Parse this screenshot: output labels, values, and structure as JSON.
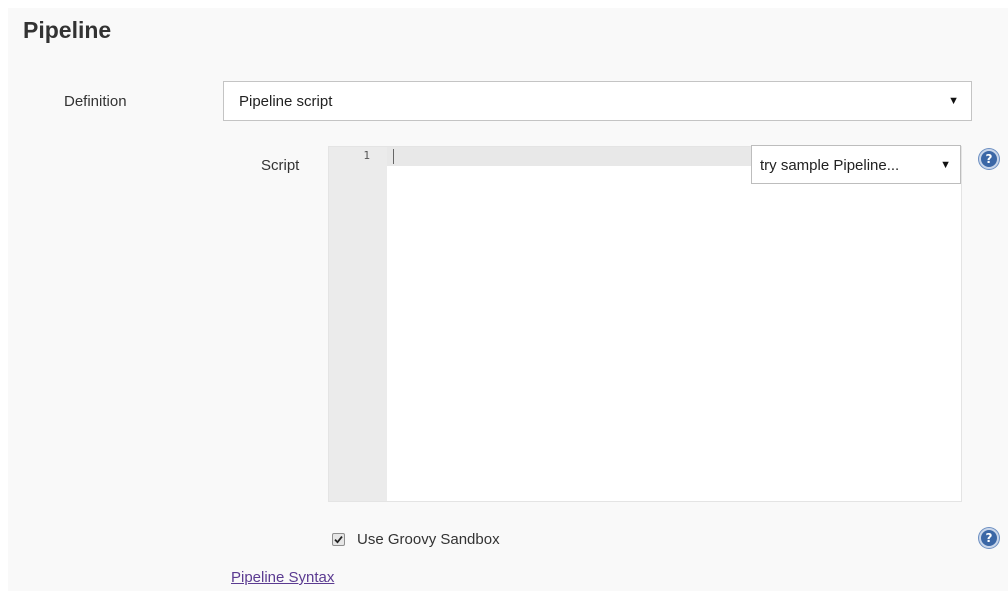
{
  "section": {
    "title": "Pipeline"
  },
  "definition": {
    "label": "Definition",
    "selected": "Pipeline script",
    "arrow_icon": "dropdown-arrow-icon"
  },
  "script": {
    "label": "Script",
    "line_numbers": [
      "1"
    ],
    "content": "",
    "sample_select": {
      "selected": "try sample Pipeline...",
      "arrow_icon": "dropdown-arrow-icon"
    },
    "help_icon": "question-mark-icon"
  },
  "sandbox": {
    "label": "Use Groovy Sandbox",
    "checked": true,
    "help_icon": "question-mark-icon"
  },
  "links": {
    "pipeline_syntax": "Pipeline Syntax"
  },
  "colors": {
    "panel_bg": "#f9f9f9",
    "help_icon": "#3b67a6",
    "link": "#5b3b91",
    "gutter": "#ebebeb"
  }
}
